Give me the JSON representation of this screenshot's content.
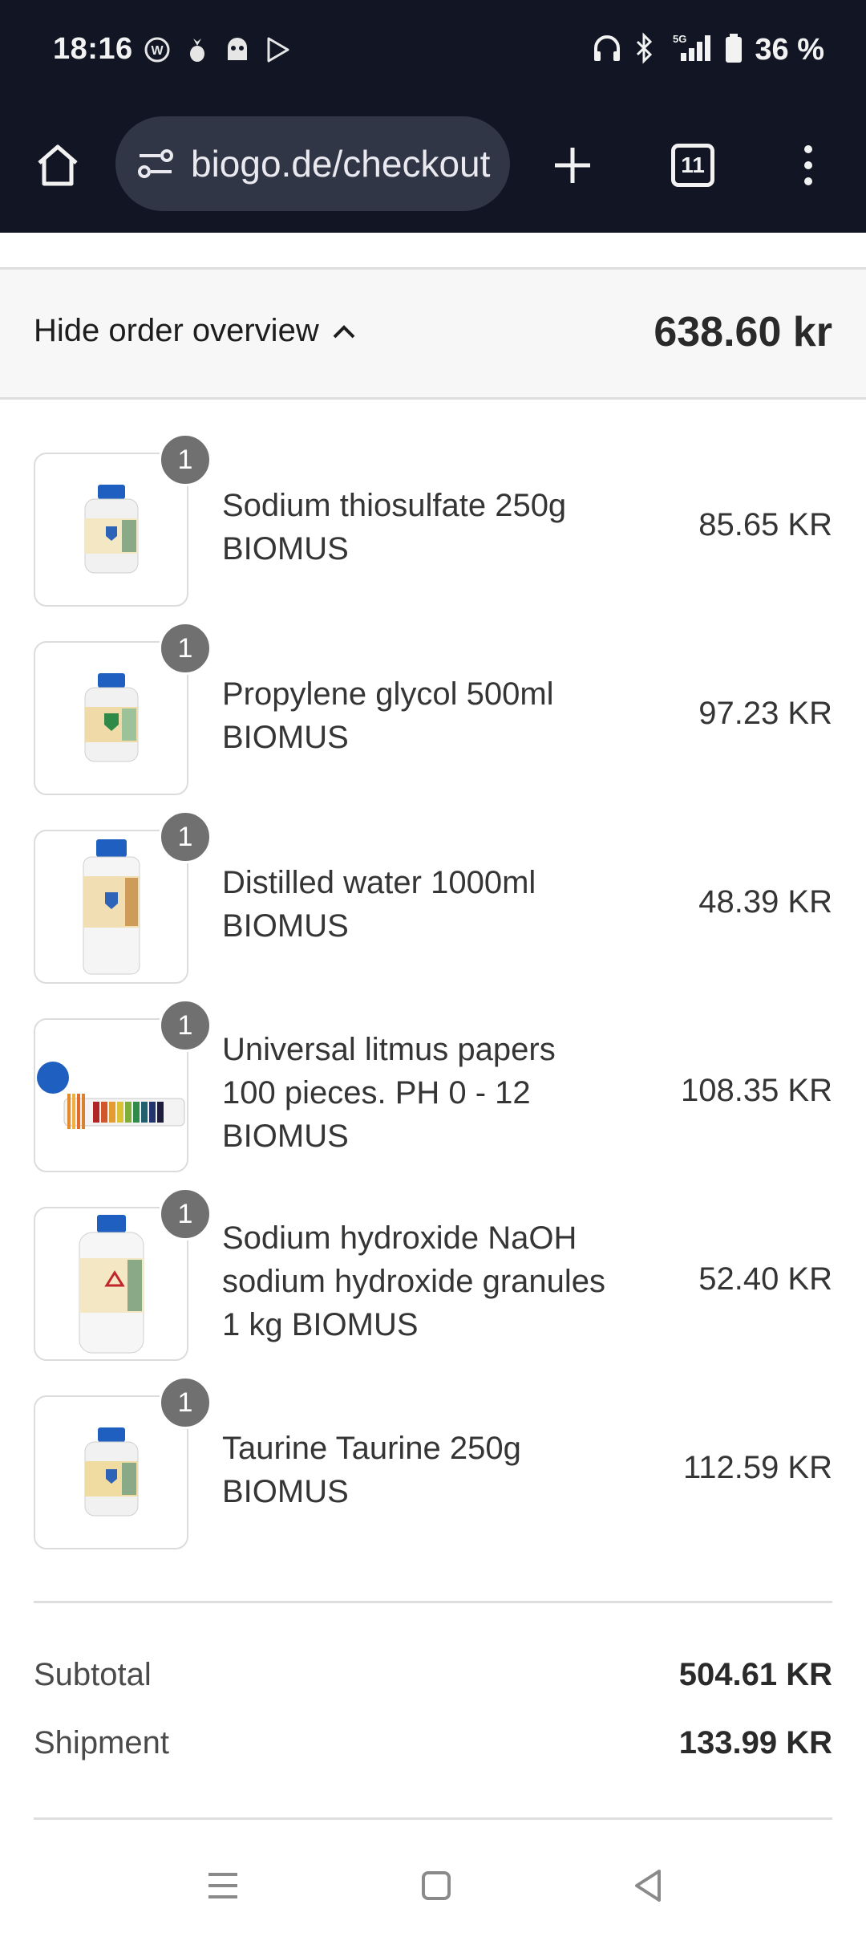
{
  "status_bar": {
    "time": "18:16",
    "battery": "36 %",
    "network": "5G",
    "notification_icons": [
      "w-badge-icon",
      "pineapple-icon",
      "ghost-icon",
      "play-store-icon"
    ],
    "system_icons": [
      "headphones-icon",
      "bluetooth-icon",
      "signal-icon",
      "battery-icon"
    ]
  },
  "browser": {
    "url": "biogo.de/checkout",
    "tab_count": "11"
  },
  "order_overview": {
    "toggle_label": "Hide order overview",
    "total": "638.60 kr"
  },
  "items": [
    {
      "name": "Sodium thiosulfate 250g BIOMUS",
      "price": "85.65 KR",
      "quantity": "1",
      "image": "bottle-small"
    },
    {
      "name": "Propylene glycol 500ml BIOMUS",
      "price": "97.23 KR",
      "quantity": "1",
      "image": "bottle-green"
    },
    {
      "name": "Distilled water 1000ml BIOMUS",
      "price": "48.39 KR",
      "quantity": "1",
      "image": "bottle-tall"
    },
    {
      "name": "Universal litmus papers 100 pieces. PH 0 - 12 BIOMUS",
      "price": "108.35 KR",
      "quantity": "1",
      "image": "litmus"
    },
    {
      "name": "Sodium hydroxide NaOH sodium hydroxide granules 1 kg BIOMUS",
      "price": "52.40 KR",
      "quantity": "1",
      "image": "bottle-large"
    },
    {
      "name": "Taurine Taurine 250g BIOMUS",
      "price": "112.59 KR",
      "quantity": "1",
      "image": "bottle-small"
    }
  ],
  "summary": {
    "subtotal_label": "Subtotal",
    "subtotal_value": "504.61 KR",
    "shipment_label": "Shipment",
    "shipment_value": "133.99 KR"
  },
  "colors": {
    "status_bar_bg": "#111524",
    "url_bar_bg": "#303646",
    "overview_bg": "#f7f7f7",
    "qty_badge": "#707070",
    "bottle_cap": "#1f5fc0"
  }
}
